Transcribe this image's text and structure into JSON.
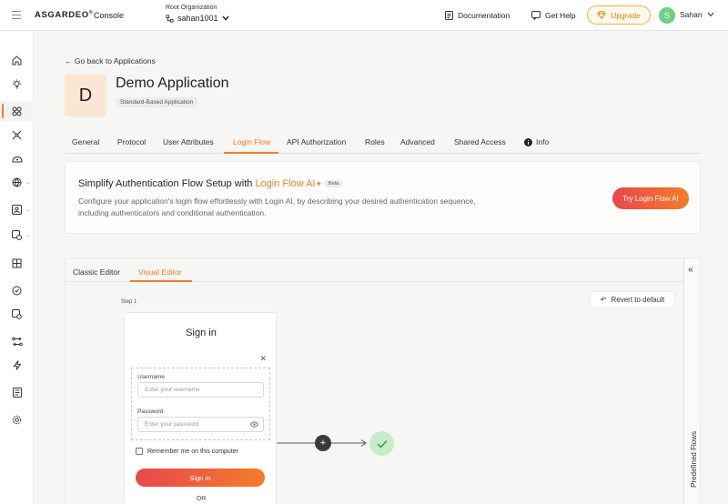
{
  "topbar": {
    "brand": "ASGARDEO",
    "brand_mark": "®",
    "product": "Console",
    "org_caption": "Root Organization",
    "org_name": "sahan1001",
    "documentation": "Documentation",
    "get_help": "Get Help",
    "upgrade": "Upgrade",
    "avatar_letter": "S",
    "user_name": "Sahan"
  },
  "sidebar": {
    "icons": [
      "home-icon",
      "lightbulb-icon",
      "apps-icon",
      "connections-icon",
      "users-icon",
      "globe-icon",
      "user-management-icon",
      "roles-icon",
      "organizations-icon",
      "branding-icon",
      "settings-icon",
      "flows-icon",
      "actions-icon",
      "logs-icon",
      "gear-icon"
    ],
    "active_index": 2
  },
  "page": {
    "back_link": "Go back to Applications",
    "app_initial": "D",
    "app_title": "Demo Application",
    "app_badge": "Standard-Based Application"
  },
  "tabs": [
    {
      "label": "General"
    },
    {
      "label": "Protocol"
    },
    {
      "label": "User Attributes"
    },
    {
      "label": "Login Flow"
    },
    {
      "label": "API Authorization"
    },
    {
      "label": "Roles"
    },
    {
      "label": "Advanced"
    },
    {
      "label": "Shared Access"
    },
    {
      "label": "Info"
    }
  ],
  "active_tab": "Login Flow",
  "ai_card": {
    "title_prefix": "Simplify Authentication Flow Setup with ",
    "title_highlight": "Login Flow AI",
    "beta": "Beta",
    "description": "Configure your application's login flow effortlessly with Login AI, by describing your desired authentication sequence, including authenticators and conditional authentication.",
    "button": "Try Login Flow AI"
  },
  "editor": {
    "tabs": [
      "Classic Editor",
      "Visual Editor"
    ],
    "active_tab": "Visual Editor",
    "step_label": "Step 1",
    "revert_button": "Revert to default",
    "side_panel": "Predefined Flows",
    "collapse_glyph": "«"
  },
  "signin_card": {
    "title": "Sign in",
    "username_label": "Username",
    "username_placeholder": "Enter your username",
    "password_label": "Password",
    "password_placeholder": "Enter your password",
    "remember": "Remember me on this computer",
    "button": "Sign In",
    "or": "OR"
  }
}
